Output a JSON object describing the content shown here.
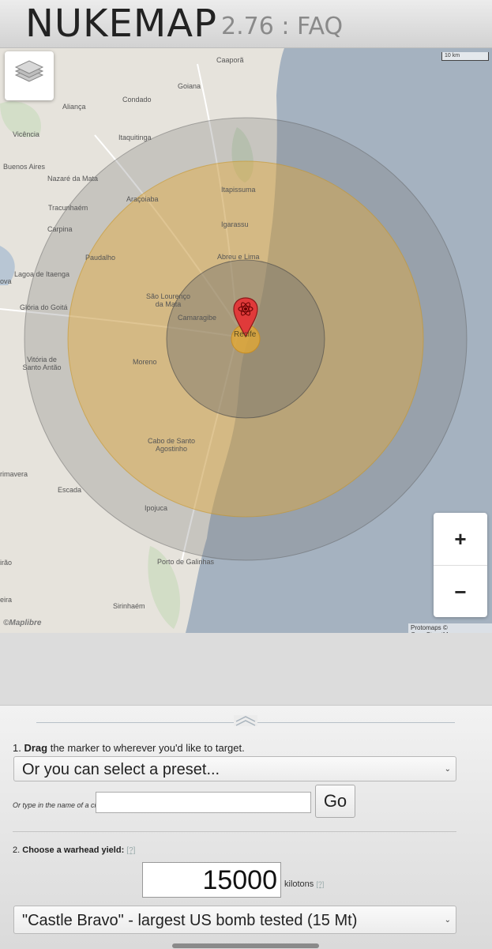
{
  "header": {
    "title": "NUKEMAP",
    "version": "2.76",
    "separator": ":",
    "faq": "FAQ"
  },
  "map": {
    "scale_label": "10 km",
    "attribution": "Protomaps © OpenStreetMap",
    "logo": "©Maplibre",
    "zoom_in": "+",
    "zoom_out": "−",
    "cities": [
      {
        "name": "Caaporã"
      },
      {
        "name": "Goiana"
      },
      {
        "name": "Condado"
      },
      {
        "name": "Aliança"
      },
      {
        "name": "Vicência"
      },
      {
        "name": "Itaquitinga"
      },
      {
        "name": "Buenos Aires"
      },
      {
        "name": "Nazaré da Mata"
      },
      {
        "name": "Itapissuma"
      },
      {
        "name": "Araçoiaba"
      },
      {
        "name": "Tracunhaém"
      },
      {
        "name": "Igarassu"
      },
      {
        "name": "Carpina"
      },
      {
        "name": "Paudalho"
      },
      {
        "name": "Abreu e Lima"
      },
      {
        "name": "Lagoa de Itaenga"
      },
      {
        "name": "ova"
      },
      {
        "name": "São Lourenço da Mata"
      },
      {
        "name": "Glória do Goitá"
      },
      {
        "name": "Camaragibe"
      },
      {
        "name": "Recife"
      },
      {
        "name": "Vitória de Santo Antão"
      },
      {
        "name": "Moreno"
      },
      {
        "name": "Cabo de Santo Agostinho"
      },
      {
        "name": "rimavera"
      },
      {
        "name": "Escada"
      },
      {
        "name": "Ipojuca"
      },
      {
        "name": "Porto de Galinhas"
      },
      {
        "name": "irão"
      },
      {
        "name": "eira"
      },
      {
        "name": "Sirinhaém"
      }
    ],
    "colors": {
      "land": "#e6e3dc",
      "sea": "#a5b2c0",
      "orange": "#e9a934",
      "gray": "#8f8f8f",
      "marker": "#e03a3a"
    },
    "icons": {
      "layers": "layers-icon",
      "marker": "atom-marker-icon"
    }
  },
  "panel": {
    "step1_num": "1.",
    "step1_bold": "Drag",
    "step1_rest": "the marker to wherever you'd like to target.",
    "preset_select": "Or you can select a preset...",
    "city_label": "Or type in the name of a city:",
    "city_value": "",
    "go": "Go",
    "step2_num": "2.",
    "step2_bold": "Choose a warhead yield:",
    "help": "[?]",
    "yield_value": "15000",
    "yield_unit": "kilotons",
    "yield_help": "[?]",
    "yield_preset": "\"Castle Bravo\" - largest US bomb tested (15 Mt)"
  }
}
